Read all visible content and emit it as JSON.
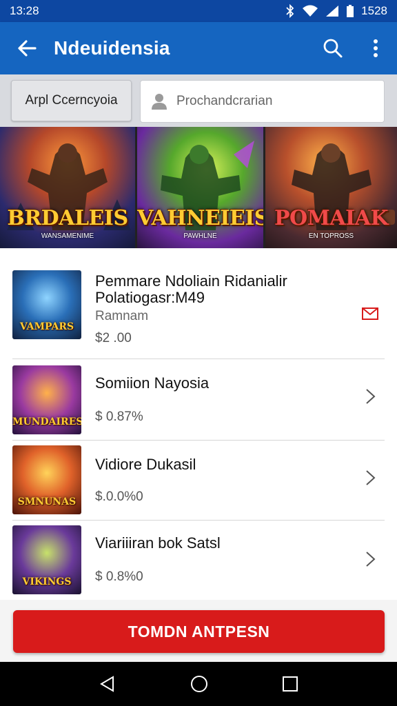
{
  "status_bar": {
    "time": "13:28",
    "battery_text": "1528",
    "icons": [
      "bluetooth-icon",
      "wifi-icon",
      "signal-icon",
      "battery-icon"
    ]
  },
  "app_bar": {
    "title": "Ndeuidensia",
    "back_icon": "arrow-back-icon",
    "search_icon": "search-icon",
    "more_icon": "more-vert-icon"
  },
  "filter": {
    "chip_label": "Arpl Ccerncyoia",
    "search_placeholder": "Prochandcrarian",
    "search_icon": "person-icon"
  },
  "banners": [
    {
      "title": "BRDALEIS",
      "subtitle": "WANSAMENIME"
    },
    {
      "title": "VAHNEIEIS",
      "subtitle": "PAWHLNE"
    },
    {
      "title": "POMAIAK",
      "subtitle": "EN TOPROSS"
    }
  ],
  "list": [
    {
      "name_line1": "Pemmare Ndoliain Ridanialir",
      "name_line2": "Polatiogasr:M49",
      "meta": "Ramnam",
      "price": "$2 .00",
      "action_icon": "mail-icon",
      "thumb_label": "VAMPARS"
    },
    {
      "name": "Somiion Nayosia",
      "price": "$ 0.87%",
      "action_icon": "chevron-right-icon",
      "thumb_label": "MUNDAIRES"
    },
    {
      "name": "Vidiore Dukasil",
      "price": "$.0.0%0",
      "action_icon": "chevron-right-icon",
      "thumb_label": "SMNUNAS"
    },
    {
      "name": "Viariiiran bok Satsl",
      "price": "$ 0.8%0",
      "action_icon": "chevron-right-icon",
      "thumb_label": "VIKINGS"
    }
  ],
  "cta": {
    "label": "TOMDN ANTPESN"
  },
  "nav_bar": {
    "icons": [
      "back-triangle-icon",
      "home-circle-icon",
      "recents-square-icon"
    ]
  },
  "colors": {
    "primary": "#1565c0",
    "status": "#0d47a1",
    "accent": "#d81b1b"
  }
}
